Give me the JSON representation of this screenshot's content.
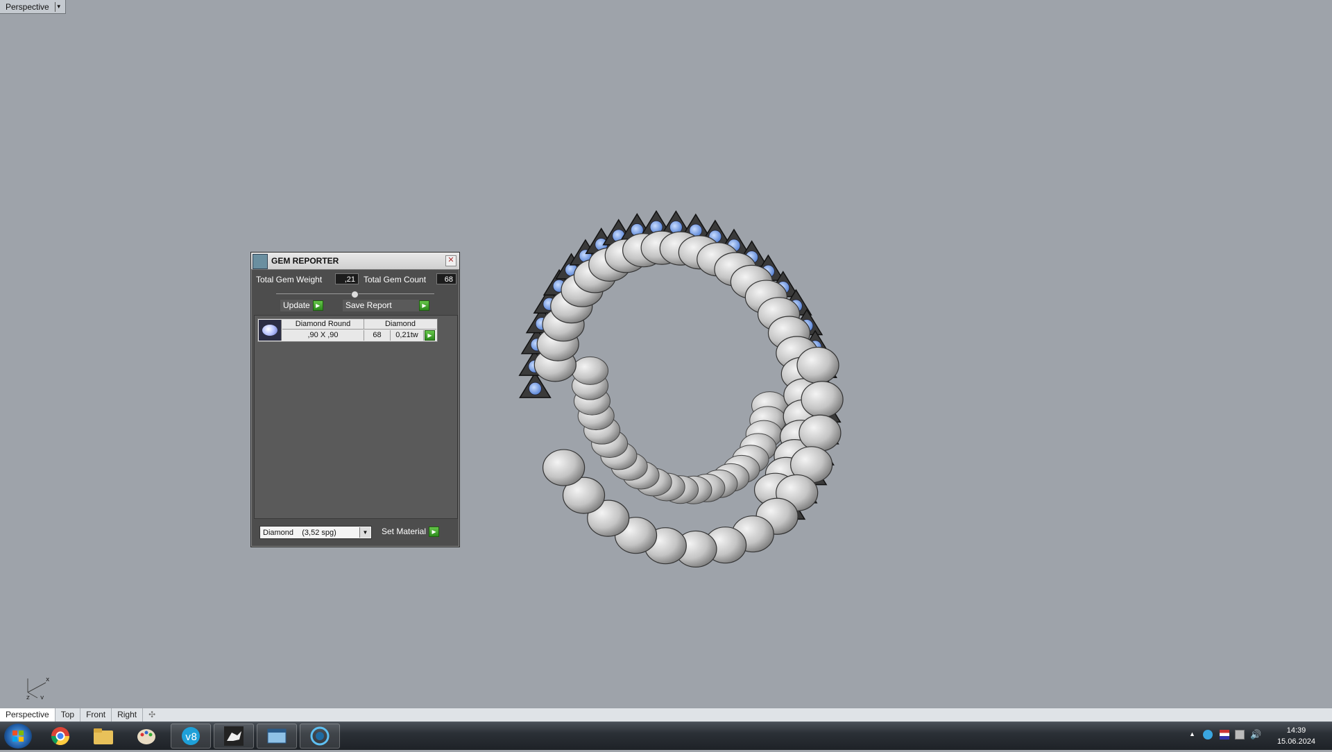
{
  "viewport": {
    "label": "Perspective",
    "dropdown_icon": "chevron-down-icon",
    "axis": {
      "x": "x",
      "y": "y",
      "z": "z"
    }
  },
  "gem_reporter": {
    "title": "GEM REPORTER",
    "total_weight_label": "Total Gem Weight",
    "total_weight_value": ",21",
    "total_count_label": "Total Gem Count",
    "total_count_value": "68",
    "update_label": "Update",
    "save_report_label": "Save Report",
    "gems": [
      {
        "shape": "Diamond Round",
        "material": "Diamond",
        "size": ",90 X ,90",
        "count": "68",
        "weight": "0,21tw"
      }
    ],
    "material_select": "Diamond    (3,52 spg)",
    "set_material_label": "Set Material"
  },
  "viewport_tabs": [
    "Perspective",
    "Top",
    "Front",
    "Right"
  ],
  "taskbar": {
    "apps": [
      "start-orb",
      "chrome-icon",
      "file-explorer-icon",
      "paint-icon",
      "vray-icon",
      "rhino-icon",
      "window-manager-icon",
      "keyshot-icon"
    ],
    "time": "14:39",
    "date": "15.06.2024"
  },
  "colors": {
    "viewport_bg": "#9ea3aa",
    "gem_blue": "#7fa9ec",
    "go_green": "#3aa02a"
  }
}
